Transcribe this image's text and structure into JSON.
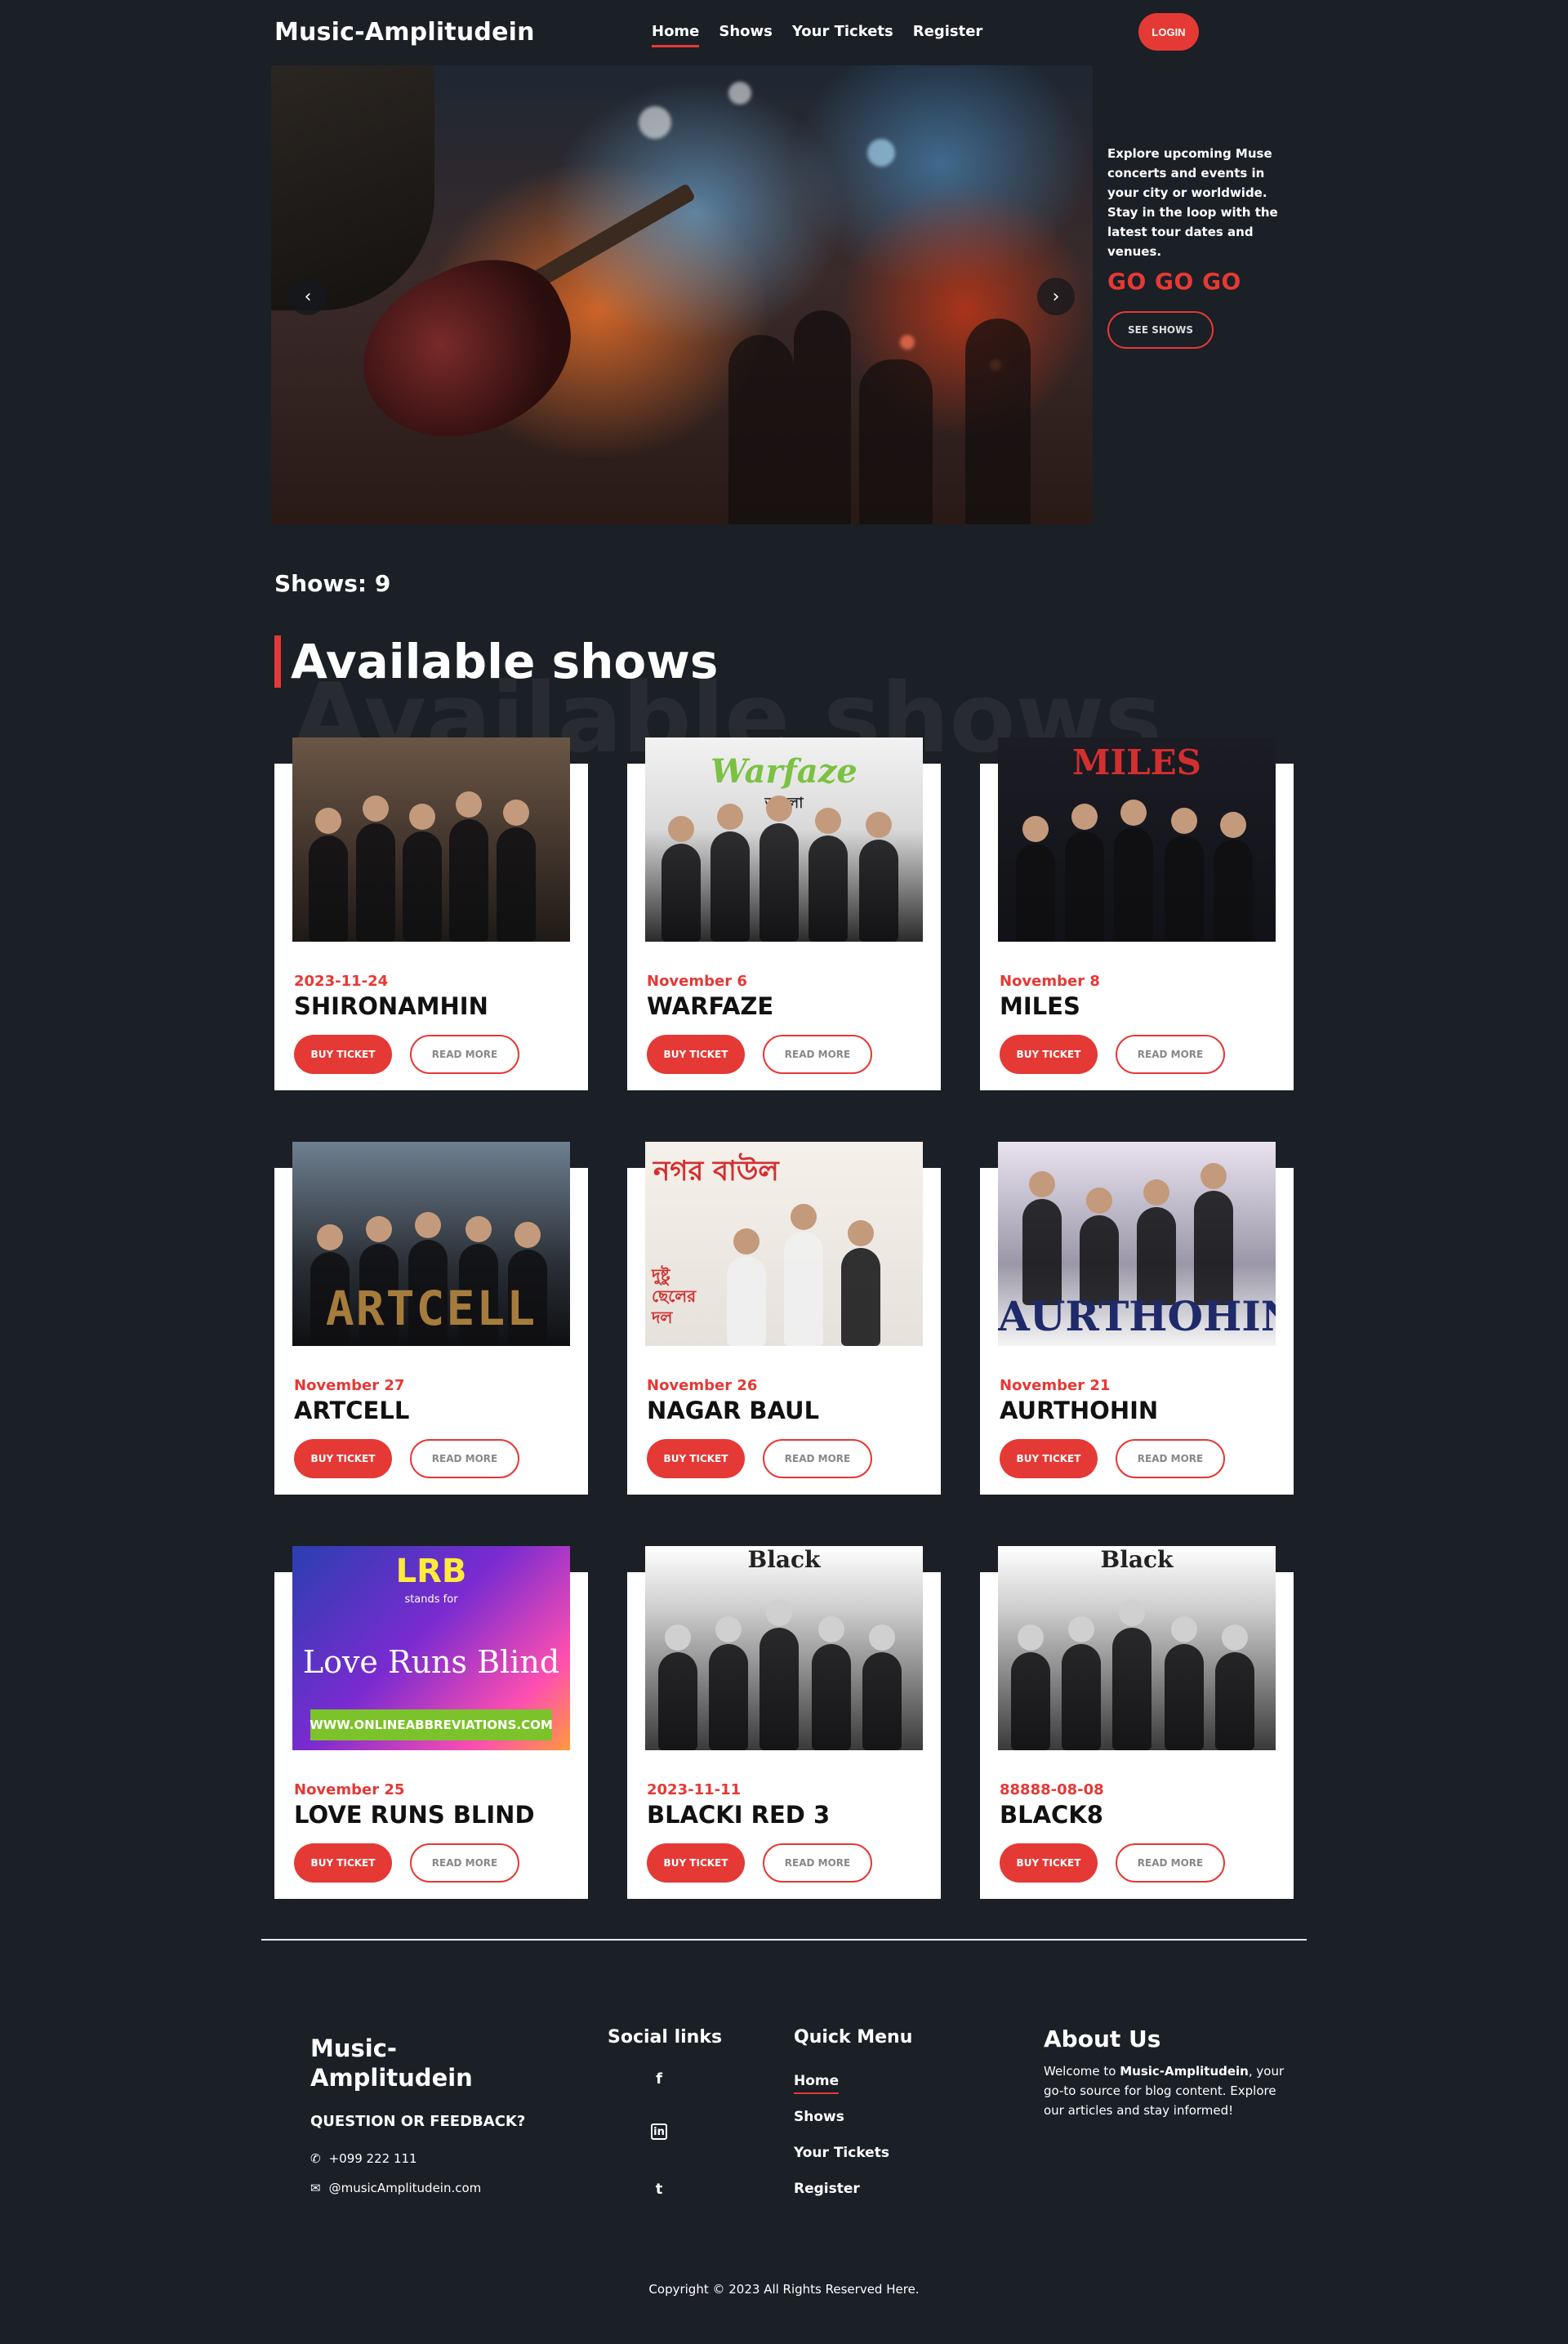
{
  "nav": {
    "brand": "Music-Amplitudein",
    "menu": [
      "Home",
      "Shows",
      "Your Tickets",
      "Register"
    ],
    "login": "LOGIN"
  },
  "hero": {
    "text": "Explore upcoming Muse concerts and events in your city or worldwide. Stay in the loop with the latest tour dates and venues.",
    "tagline": "GO GO GO",
    "cta": "SEE SHOWS",
    "prev_icon": "‹",
    "next_icon": "›"
  },
  "shows": {
    "count_label": "Shows: 9",
    "title": "Available shows",
    "ghost": "Available shows",
    "buy_label": "BUY TICKET",
    "more_label": "READ MORE",
    "items": [
      {
        "date": "2023-11-24",
        "name": "SHIRONAMHIN"
      },
      {
        "date": "November 6",
        "name": "WARFAZE",
        "logo": "Warfaze",
        "logo_sub": "আলো"
      },
      {
        "date": "November 8",
        "name": "MILES",
        "logo": "MILES"
      },
      {
        "date": "November 27",
        "name": "ARTCELL",
        "logo": "ARTCELL"
      },
      {
        "date": "November 26",
        "name": "NAGAR BAUL",
        "logo": "নগর বাউল",
        "logo_sub": "দুষ্টু ছেলের দল"
      },
      {
        "date": "November 21",
        "name": "AURTHOHIN",
        "logo": "AURTHOHIN"
      },
      {
        "date": "November 25",
        "name": "LOVE RUNS BLIND",
        "logo": "LRB",
        "logo_sub": "stands for",
        "logo_main": "Love Runs Blind",
        "logo_url": "WWW.ONLINEABBREVIATIONS.COM"
      },
      {
        "date": "2023-11-11",
        "name": "BLACKI RED 3",
        "logo": "Black"
      },
      {
        "date": "88888-08-08",
        "name": "BLACK8",
        "logo": "Black"
      }
    ]
  },
  "footer": {
    "brand": "Music-Amplitudein",
    "question": "QUESTION OR FEEDBACK?",
    "phone": "+099 222 111",
    "email": "@musicAmplitudein.com",
    "social_title": "Social links",
    "social_icons": [
      "f",
      "in",
      "t"
    ],
    "quick_title": "Quick Menu",
    "quick": [
      "Home",
      "Shows",
      "Your Tickets",
      "Register"
    ],
    "about_title": "About Us",
    "about_prefix": "Welcome to ",
    "about_brand": "Music-Amplitudein",
    "about_suffix": ", your go-to source for blog content. Explore our articles and stay informed!",
    "copyright": "Copyright © 2023 All Rights Reserved Here."
  }
}
